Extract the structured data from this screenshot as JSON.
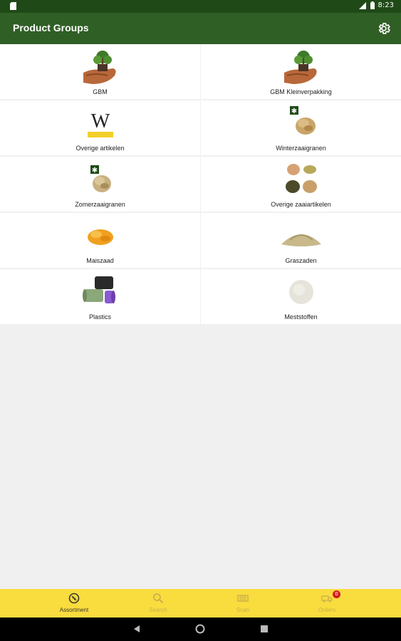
{
  "status_bar": {
    "time": "8:23"
  },
  "app_bar": {
    "title": "Product Groups"
  },
  "tiles": [
    {
      "label": "GBM",
      "icon": "plant-in-hand"
    },
    {
      "label": "GBM Kleinverpakking",
      "icon": "plant-in-hand"
    },
    {
      "label": "Overige artikelen",
      "icon": "w-logo"
    },
    {
      "label": "Winterzaaigranen",
      "icon": "grain-pile-snow"
    },
    {
      "label": "Zomerzaaigranen",
      "icon": "grain-pile-snow"
    },
    {
      "label": "Overige zaaiartikelen",
      "icon": "seed-piles"
    },
    {
      "label": "Maiszaad",
      "icon": "corn-seed-pile"
    },
    {
      "label": "Graszaden",
      "icon": "grass-seed-pile"
    },
    {
      "label": "Plastics",
      "icon": "plastic-rolls"
    },
    {
      "label": "Meststoffen",
      "icon": "fertilizer-pile"
    }
  ],
  "bottom_nav": [
    {
      "label": "Assortment",
      "icon": "assortment-icon",
      "active": true
    },
    {
      "label": "Search",
      "icon": "search-icon",
      "active": false
    },
    {
      "label": "Scan",
      "icon": "scan-icon",
      "active": false
    },
    {
      "label": "Orders",
      "icon": "truck-icon",
      "active": false,
      "badge": "0"
    }
  ],
  "colors": {
    "status_bar": "#1f4a18",
    "app_bar": "#2f5f25",
    "bottom_nav": "#f9dc3e",
    "badge": "#d21f1f"
  }
}
